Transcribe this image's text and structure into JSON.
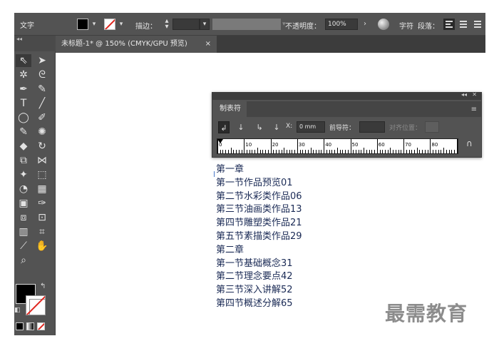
{
  "control_bar": {
    "object_type": "文字",
    "stroke_label": "描边：",
    "opacity_label": "不透明度：",
    "opacity_value": "100%",
    "character_label": "字符",
    "paragraph_label": "段落："
  },
  "document": {
    "tab_title": "未标题-1* @ 150% (CMYK/GPU 预览)",
    "tab_close": "×",
    "lines": [
      "第一章",
      "第一节作品预览01",
      "第二节水彩类作品06",
      "第三节油画类作品13",
      "第四节雕塑类作品21",
      "第五节素描类作品29",
      "第二章",
      "第一节基础概念31",
      "第二节理念要点42",
      "第三节深入讲解52",
      "第四节概述分解65"
    ]
  },
  "tabs_panel": {
    "title": "制表符",
    "x_label": "X:",
    "x_value": "0 mm",
    "leader_label": "前导符：",
    "align_on_label": "对齐位置：",
    "ruler_numbers": [
      "0",
      "10",
      "20",
      "30",
      "40",
      "50",
      "60",
      "70",
      "80",
      "90"
    ]
  },
  "watermark": "最需教育",
  "colors": {
    "panel_bg": "#535353",
    "panel_dark": "#3c3c3c",
    "doc_text": "#1a2a55",
    "stroke_none_red": "#e0261f"
  }
}
